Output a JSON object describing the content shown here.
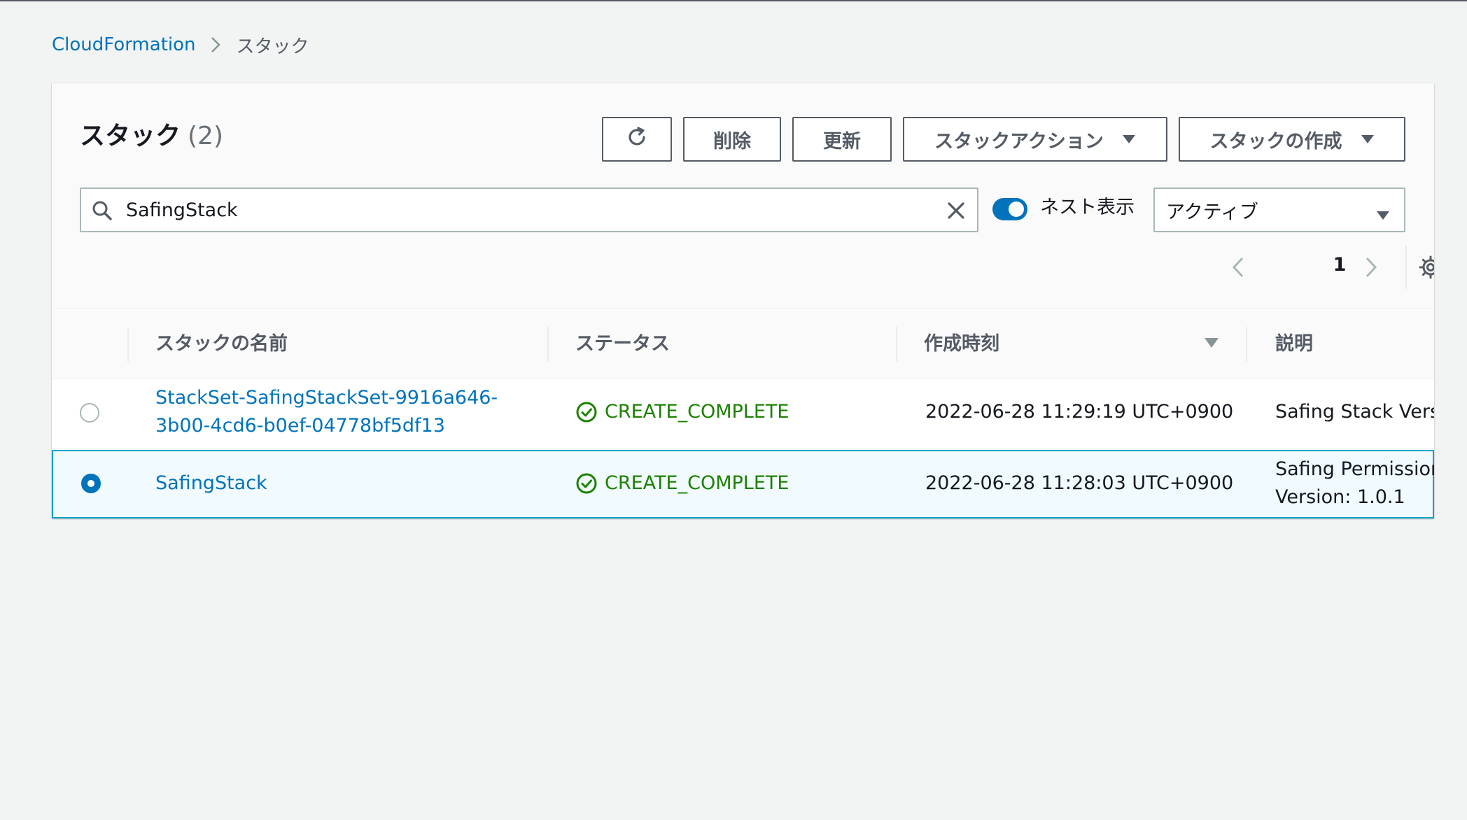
{
  "breadcrumb": {
    "root": "CloudFormation",
    "current": "スタック"
  },
  "header": {
    "title": "スタック",
    "count": "(2)"
  },
  "toolbar": {
    "delete_label": "削除",
    "update_label": "更新",
    "actions_label": "スタックアクション",
    "create_label": "スタックの作成"
  },
  "filter": {
    "search_value": "SafingStack",
    "nested_toggle_label": "ネスト表示",
    "nested_enabled": true,
    "status_selected": "アクティブ"
  },
  "pagination": {
    "current_page": "1"
  },
  "table": {
    "columns": {
      "name": "スタックの名前",
      "status": "ステータス",
      "created": "作成時刻",
      "description": "説明"
    },
    "rows": [
      {
        "name_line1": "StackSet-SafingStackSet-9916a646-",
        "name_line2": "3b00-4cd6-b0ef-04778bf5df13",
        "status": "CREATE_COMPLETE",
        "created": "2022-06-28 11:29:19 UTC+0900",
        "description": "Safing Stack Versi",
        "selected": false
      },
      {
        "name": "SafingStack",
        "status": "CREATE_COMPLETE",
        "created": "2022-06-28 11:28:03 UTC+0900",
        "description_line1": "Safing Permission",
        "description_line2": "Version: 1.0.1",
        "selected": true
      }
    ]
  },
  "colors": {
    "link": "#0073bb",
    "success": "#1d8102",
    "selected_row_bg": "#f1faff",
    "selected_row_border": "#00a1c9"
  }
}
